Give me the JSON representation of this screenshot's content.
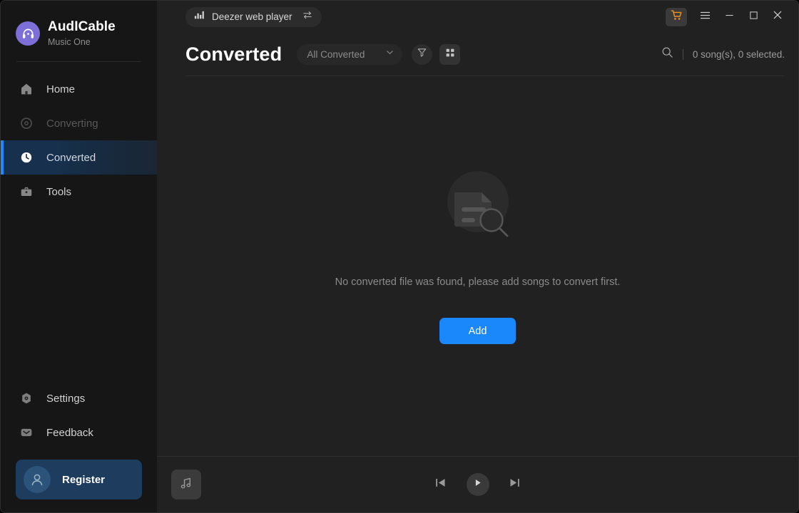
{
  "app": {
    "brand_name": "AudICable",
    "brand_sub": "Music One"
  },
  "sidebar": {
    "items": [
      {
        "label": "Home",
        "icon": "home-icon",
        "state": "normal"
      },
      {
        "label": "Converting",
        "icon": "converting-icon",
        "state": "disabled"
      },
      {
        "label": "Converted",
        "icon": "clock-icon",
        "state": "active"
      },
      {
        "label": "Tools",
        "icon": "toolbox-icon",
        "state": "normal"
      }
    ],
    "bottom_items": [
      {
        "label": "Settings",
        "icon": "gear-icon"
      },
      {
        "label": "Feedback",
        "icon": "envelope-icon"
      }
    ],
    "register_label": "Register",
    "active_accent": "#1a8cff"
  },
  "titlebar": {
    "source_label": "Deezer web player",
    "source_icon": "equalizer-icon",
    "swap_icon": "swap-arrows-icon",
    "cart_icon": "shopping-cart-icon",
    "cart_color": "#f39019",
    "menu_icon": "hamburger-menu-icon",
    "minimize_icon": "minimize-icon",
    "maximize_icon": "maximize-icon",
    "close_icon": "close-icon"
  },
  "header": {
    "title": "Converted",
    "filter_value": "All Converted",
    "filter_icon": "funnel-icon",
    "grid_icon": "grid-view-icon",
    "search_icon": "search-icon",
    "count_text": "0 song(s), 0 selected."
  },
  "empty_state": {
    "illustration": "no-file-found-illustration",
    "message": "No converted file was found, please add songs to convert first.",
    "add_label": "Add",
    "add_color": "#1a87fb"
  },
  "player": {
    "album_art_icon": "music-note-icon",
    "prev_icon": "previous-track-icon",
    "play_icon": "play-icon",
    "next_icon": "next-track-icon"
  }
}
